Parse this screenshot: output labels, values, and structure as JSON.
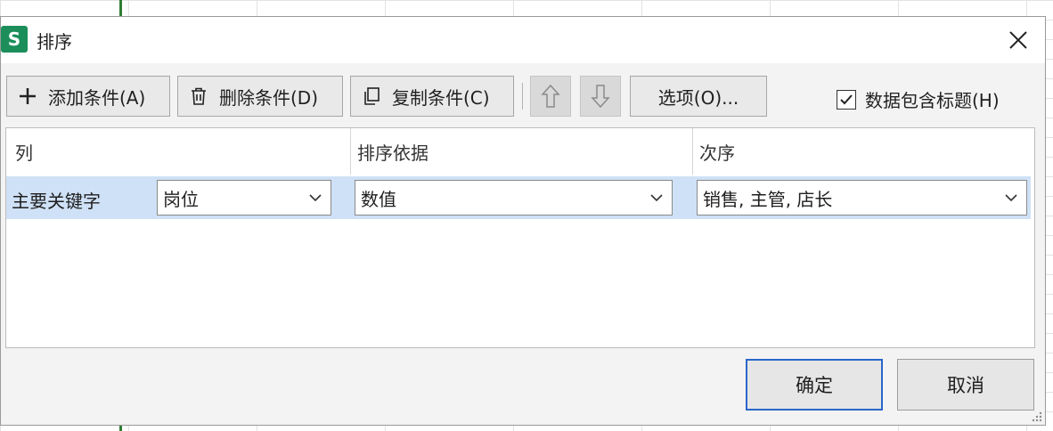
{
  "dialog": {
    "app_icon_letter": "S",
    "title": "排序",
    "close_label": "×"
  },
  "toolbar": {
    "add": "添加条件(A)",
    "delete": "删除条件(D)",
    "copy": "复制条件(C)",
    "options": "选项(O)...",
    "header_checkbox_label": "数据包含标题(H)",
    "header_checkbox_checked": true
  },
  "table": {
    "columns": [
      "列",
      "排序依据",
      "次序"
    ],
    "rows": [
      {
        "label": "主要关键字",
        "column": "岗位",
        "sort_on": "数值",
        "order": "销售, 主管, 店长"
      }
    ]
  },
  "footer": {
    "ok": "确定",
    "cancel": "取消"
  },
  "colors": {
    "accent": "#2a66c9",
    "row_selected": "#cfe1f6",
    "app_icon": "#1b8e5a"
  }
}
